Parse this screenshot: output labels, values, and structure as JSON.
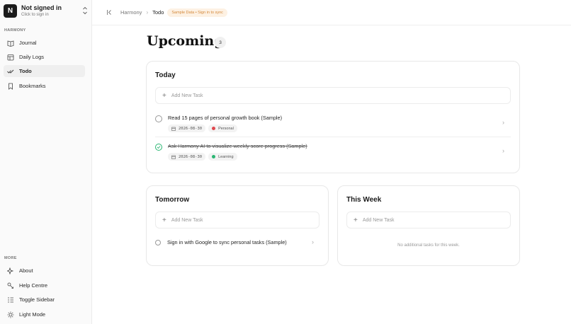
{
  "account": {
    "initial": "N",
    "name": "Not signed in",
    "subtitle": "Click to sign in"
  },
  "sidebar": {
    "section": "HARMONY",
    "items": [
      {
        "label": "Journal",
        "icon": "book-open-icon"
      },
      {
        "label": "Daily Logs",
        "icon": "calendar-grid-icon"
      },
      {
        "label": "Todo",
        "icon": "check-double-icon",
        "active": true
      },
      {
        "label": "Bookmarks",
        "icon": "bookmark-icon"
      }
    ],
    "more_section": "MORE",
    "more_items": [
      {
        "label": "About",
        "icon": "sparkles-icon"
      },
      {
        "label": "Help Centre",
        "icon": "help-icon"
      },
      {
        "label": "Toggle Sidebar",
        "icon": "sidebar-icon"
      },
      {
        "label": "Light Mode",
        "icon": "sun-icon"
      }
    ]
  },
  "breadcrumb": {
    "root": "Harmony",
    "current": "Todo",
    "badge": "Sample Data • Sign in to sync"
  },
  "page": {
    "title": "Upcoming",
    "count": "3"
  },
  "today": {
    "title": "Today",
    "add_placeholder": "Add New Task",
    "tasks": [
      {
        "title": "Read 15 pages of personal growth book (Sample)",
        "date": "2026-08-30",
        "tag": "Personal",
        "tag_color": "#e0484f",
        "done": false
      },
      {
        "title": "Ask Harmony AI to visualize weekly score progress (Sample)",
        "date": "2026-08-30",
        "tag": "Learning",
        "tag_color": "#2bb673",
        "done": true
      }
    ]
  },
  "tomorrow": {
    "title": "Tomorrow",
    "add_placeholder": "Add New Task",
    "tasks": [
      {
        "title": "Sign in with Google to sync personal tasks (Sample)",
        "done": false
      }
    ]
  },
  "this_week": {
    "title": "This Week",
    "add_placeholder": "Add New Task",
    "empty_text": "No additional tasks for this week."
  }
}
